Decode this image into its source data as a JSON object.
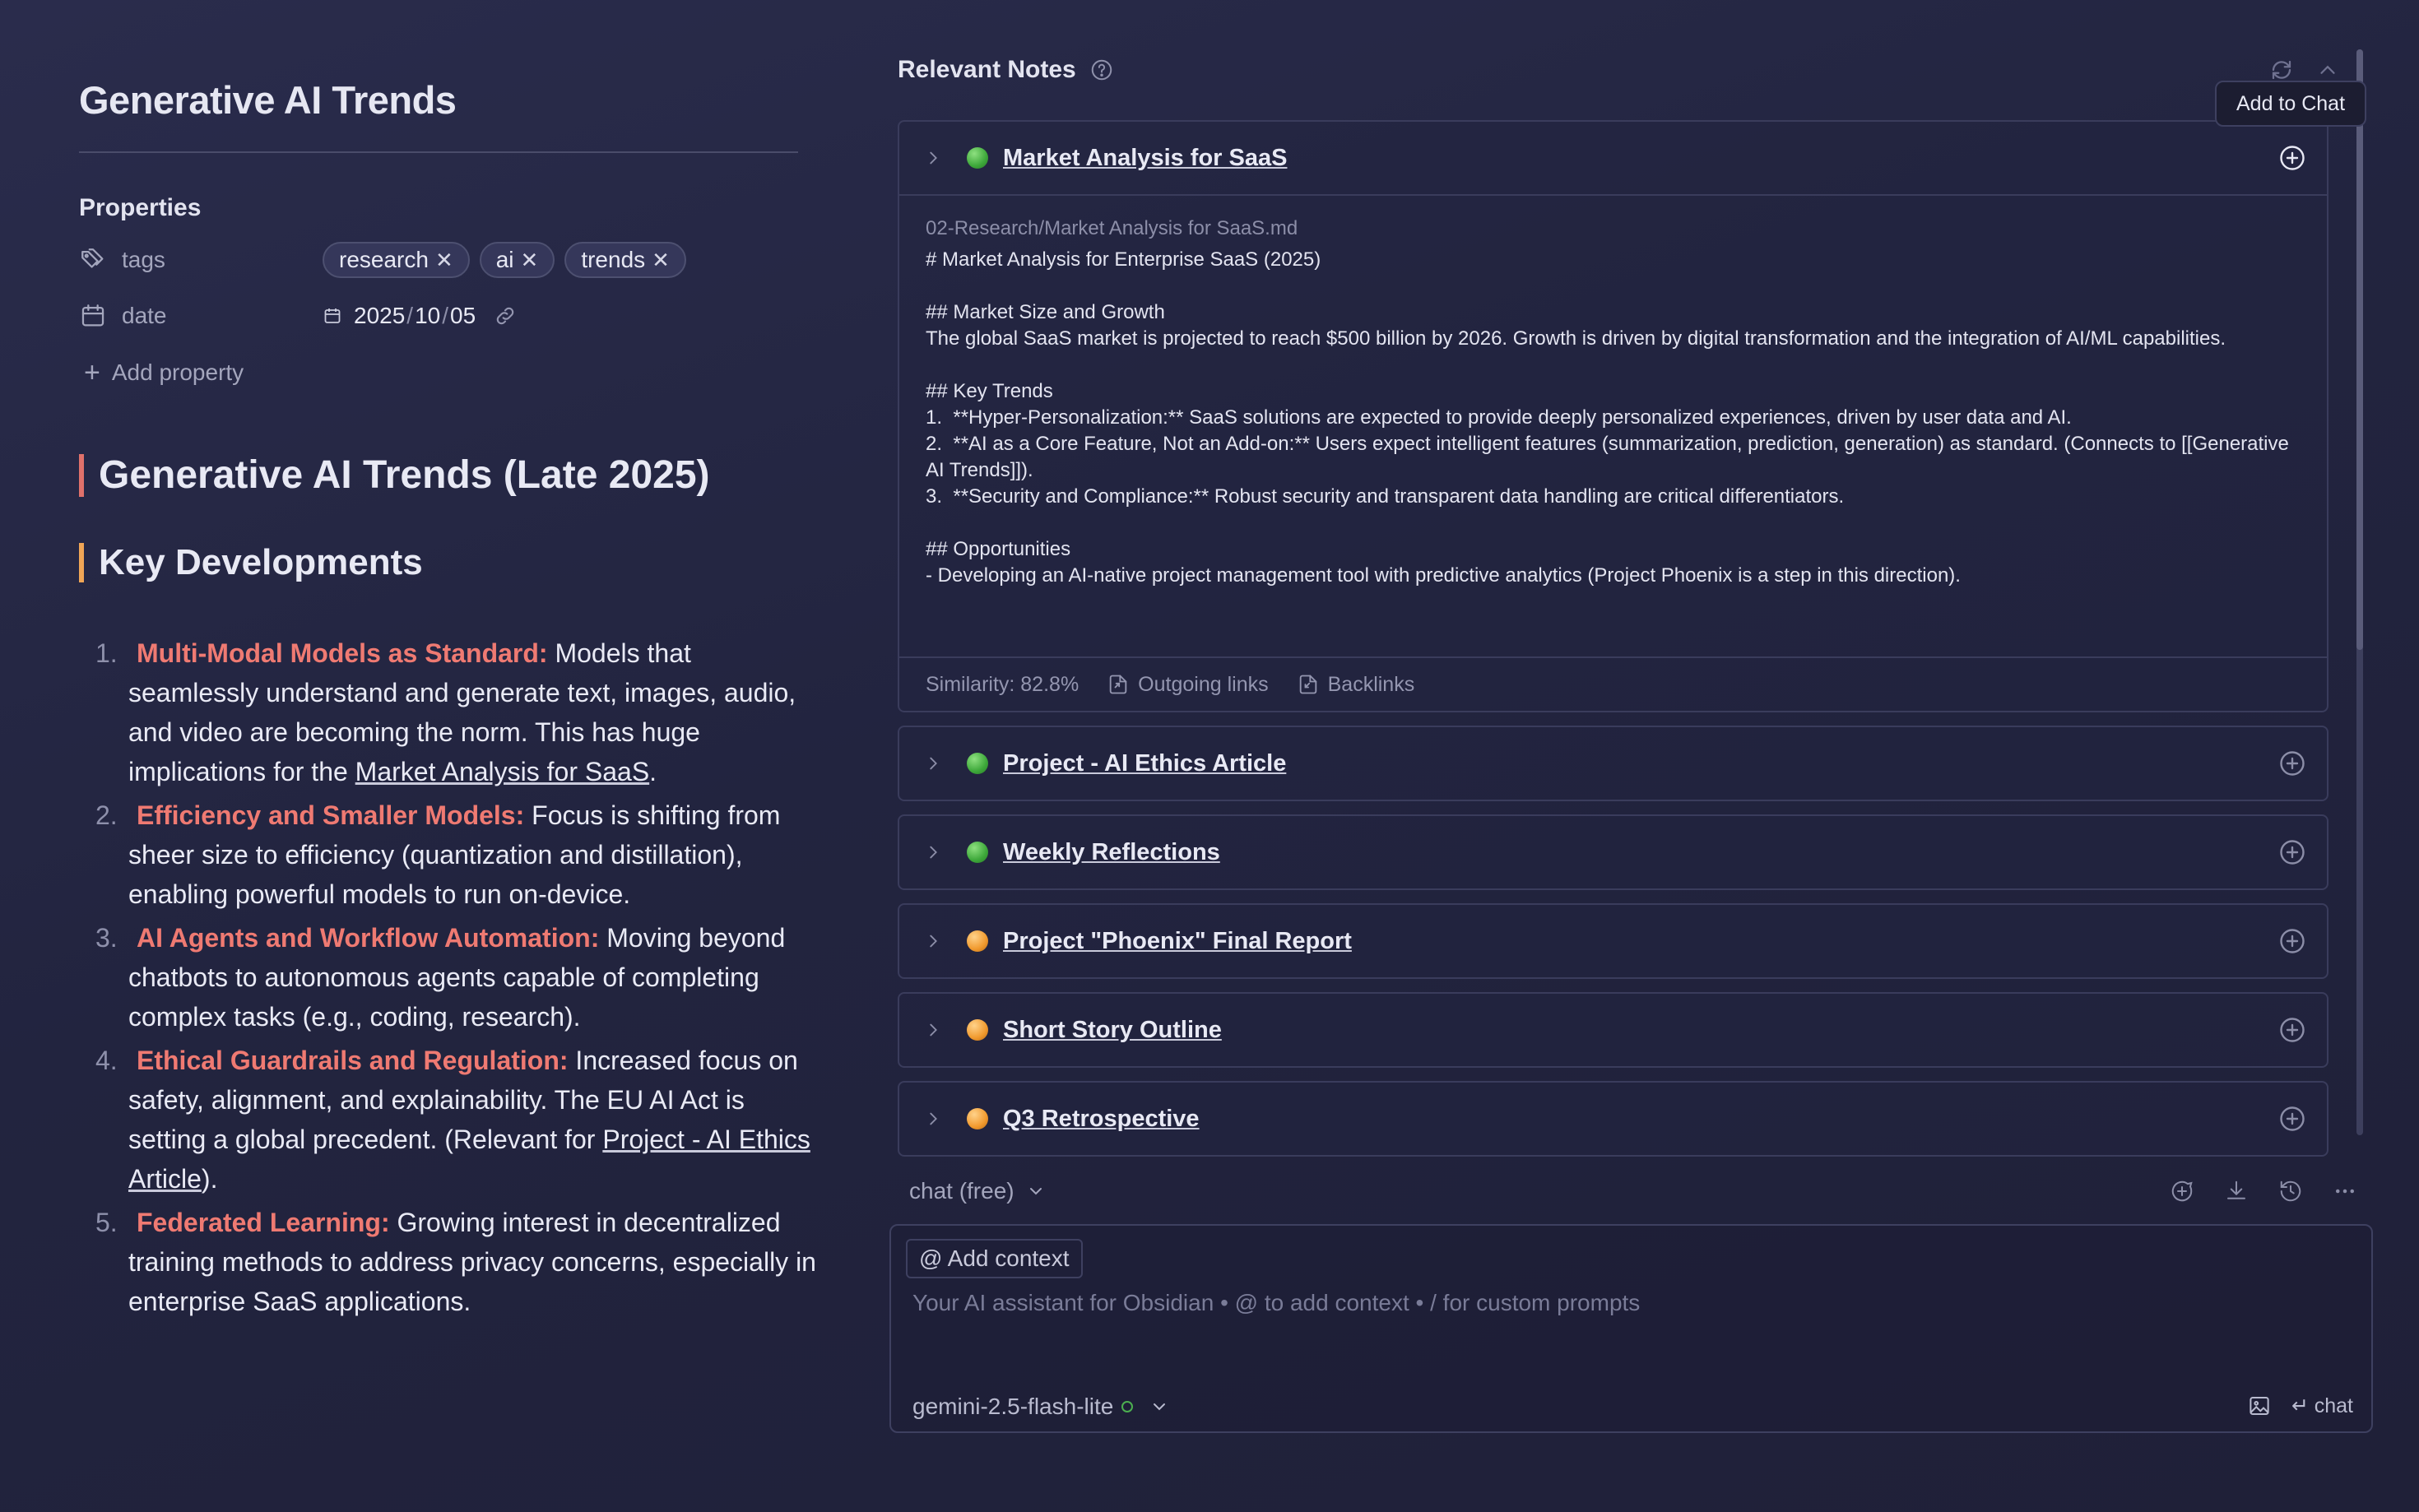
{
  "note": {
    "title": "Generative AI Trends",
    "properties_heading": "Properties",
    "properties": {
      "tags_key": "tags",
      "tags": [
        "research",
        "ai",
        "trends"
      ],
      "date_key": "date",
      "date_parts": [
        "2025",
        "10",
        "05"
      ],
      "add_property": "Add property"
    },
    "h1": "Generative AI Trends (Late 2025)",
    "h2": "Key Developments",
    "developments": [
      {
        "num": "1.",
        "head": "Multi-Modal Models as Standard:",
        "text": " Models that seamlessly understand and generate text, images, audio, and video are becoming the norm. This has huge implications for the ",
        "link": "Market Analysis for SaaS",
        "tail": "."
      },
      {
        "num": "2.",
        "head": "Efficiency and Smaller Models:",
        "text": " Focus is shifting from sheer size to efficiency (quantization and distillation), enabling powerful models to run on-device.",
        "link": "",
        "tail": ""
      },
      {
        "num": "3.",
        "head": "AI Agents and Workflow Automation:",
        "text": " Moving beyond chatbots to autonomous agents capable of completing complex tasks (e.g., coding, research).",
        "link": "",
        "tail": ""
      },
      {
        "num": "4.",
        "head": "Ethical Guardrails and Regulation:",
        "text": " Increased focus on safety, alignment, and explainability. The EU AI Act is setting a global precedent. (Relevant for ",
        "link": "Project - AI Ethics Article",
        "tail": ")."
      },
      {
        "num": "5.",
        "head": "Federated Learning:",
        "text": " Growing interest in decentralized training methods to address privacy concerns, especially in enterprise SaaS applications.",
        "link": "",
        "tail": ""
      }
    ]
  },
  "sidebar": {
    "title": "Relevant Notes",
    "tooltip": "Add to Chat",
    "expanded": {
      "title": "Market Analysis for SaaS",
      "status": "green",
      "path": "02-Research/Market Analysis for SaaS.md",
      "content": "# Market Analysis for Enterprise SaaS (2025)\n\n## Market Size and Growth\nThe global SaaS market is projected to reach $500 billion by 2026. Growth is driven by digital transformation and the integration of AI/ML capabilities.\n\n## Key Trends\n1.  **Hyper-Personalization:** SaaS solutions are expected to provide deeply personalized experiences, driven by user data and AI.\n2.  **AI as a Core Feature, Not an Add-on:** Users expect intelligent features (summarization, prediction, generation) as standard. (Connects to [[Generative AI Trends]]).\n3.  **Security and Compliance:** Robust security and transparent data handling are critical differentiators.\n\n## Opportunities\n- Developing an AI-native project management tool with predictive analytics (Project Phoenix is a step in this direction).",
      "similarity": "Similarity: 82.8%",
      "outgoing": "Outgoing links",
      "backlinks": "Backlinks"
    },
    "notes": [
      {
        "title": "Project - AI Ethics Article",
        "status": "green"
      },
      {
        "title": "Weekly Reflections",
        "status": "green"
      },
      {
        "title": "Project \"Phoenix\" Final Report",
        "status": "orange"
      },
      {
        "title": "Short Story Outline",
        "status": "orange"
      },
      {
        "title": "Q3 Retrospective",
        "status": "orange"
      }
    ]
  },
  "chat": {
    "mode": "chat (free)",
    "add_context": "@ Add context",
    "placeholder": "Your AI assistant for Obsidian • @ to add context • / for custom prompts",
    "model": "gemini-2.5-flash-lite",
    "send_label": "↵ chat"
  },
  "colors": {
    "accent_red": "#ef7a72",
    "accent_orange": "#f0a656",
    "status_green": "#3da83a",
    "status_orange": "#f19a2e"
  }
}
